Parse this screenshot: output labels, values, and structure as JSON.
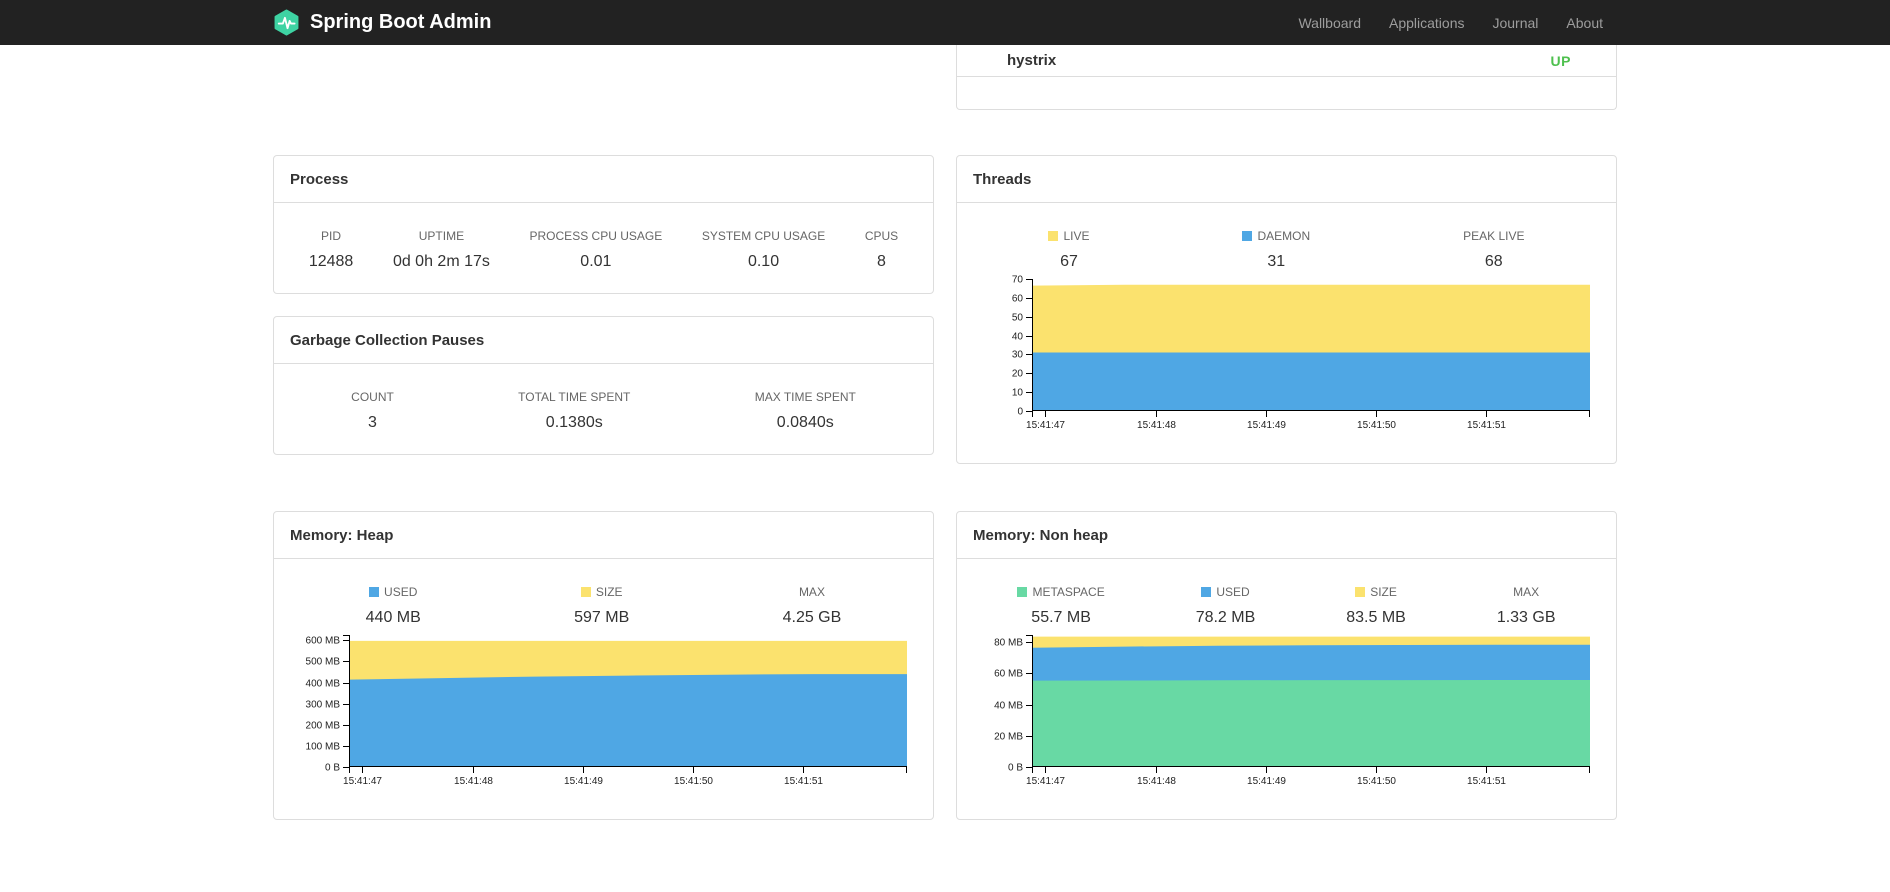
{
  "navbar": {
    "brand": "Spring Boot Admin",
    "items": [
      {
        "label": "Wallboard"
      },
      {
        "label": "Applications"
      },
      {
        "label": "Journal"
      },
      {
        "label": "About"
      }
    ]
  },
  "colors": {
    "logo_green": "#3ED3A3",
    "status_up": "#4EC04E",
    "series_blue": "#4FA7E4",
    "series_yellow": "#FBE26E",
    "series_green": "#68D9A4"
  },
  "application_row": {
    "name": "hystrix",
    "status": "UP"
  },
  "process": {
    "title": "Process",
    "stats": [
      {
        "label": "PID",
        "value": "12488"
      },
      {
        "label": "UPTIME",
        "value": "0d 0h 2m 17s"
      },
      {
        "label": "PROCESS CPU USAGE",
        "value": "0.01"
      },
      {
        "label": "SYSTEM CPU USAGE",
        "value": "0.10"
      },
      {
        "label": "CPUS",
        "value": "8"
      }
    ]
  },
  "gc": {
    "title": "Garbage Collection Pauses",
    "stats": [
      {
        "label": "COUNT",
        "value": "3"
      },
      {
        "label": "TOTAL TIME SPENT",
        "value": "0.1380s"
      },
      {
        "label": "MAX TIME SPENT",
        "value": "0.0840s"
      }
    ]
  },
  "threads": {
    "title": "Threads",
    "legend": [
      {
        "label": "LIVE",
        "color": "#FBE26E",
        "value": "67"
      },
      {
        "label": "DAEMON",
        "color": "#4FA7E4",
        "value": "31"
      },
      {
        "label": "PEAK LIVE",
        "value": "68"
      }
    ]
  },
  "heap": {
    "title": "Memory: Heap",
    "legend": [
      {
        "label": "USED",
        "color": "#4FA7E4",
        "value": "440 MB"
      },
      {
        "label": "SIZE",
        "color": "#FBE26E",
        "value": "597 MB"
      },
      {
        "label": "MAX",
        "value": "4.25 GB"
      }
    ]
  },
  "nonheap": {
    "title": "Memory: Non heap",
    "legend": [
      {
        "label": "METASPACE",
        "color": "#68D9A4",
        "value": "55.7 MB"
      },
      {
        "label": "USED",
        "color": "#4FA7E4",
        "value": "78.2 MB"
      },
      {
        "label": "SIZE",
        "color": "#FBE26E",
        "value": "83.5 MB"
      },
      {
        "label": "MAX",
        "value": "1.33 GB"
      }
    ]
  },
  "chart_data": [
    {
      "id": "threads",
      "type": "area",
      "title": "Threads",
      "xlabel": "",
      "ylabel": "",
      "ylim": [
        0,
        70
      ],
      "yticks": [
        {
          "v": 0,
          "label": "0"
        },
        {
          "v": 10,
          "label": "10"
        },
        {
          "v": 20,
          "label": "20"
        },
        {
          "v": 30,
          "label": "30"
        },
        {
          "v": 40,
          "label": "40"
        },
        {
          "v": 50,
          "label": "50"
        },
        {
          "v": 60,
          "label": "60"
        },
        {
          "v": 70,
          "label": "70"
        }
      ],
      "xticks": [
        {
          "pos": 0.024,
          "label": "15:41:47"
        },
        {
          "pos": 0.2216,
          "label": "15:41:48"
        },
        {
          "pos": 0.4192,
          "label": "15:41:49"
        },
        {
          "pos": 0.6168,
          "label": "15:41:50"
        },
        {
          "pos": 0.8144,
          "label": "15:41:51"
        }
      ],
      "series": [
        {
          "name": "live",
          "color": "#FBE26E",
          "values": [
            66.5,
            67,
            67,
            67,
            67,
            67,
            67
          ]
        },
        {
          "name": "daemon",
          "color": "#4FA7E4",
          "values": [
            31,
            31,
            31,
            31,
            31,
            31,
            31
          ]
        }
      ]
    },
    {
      "id": "heap",
      "type": "area",
      "title": "Memory: Heap",
      "xlabel": "",
      "ylabel": "",
      "ylim": [
        0,
        625
      ],
      "yticks": [
        {
          "v": 0,
          "label": "0 B"
        },
        {
          "v": 100,
          "label": "100 MB"
        },
        {
          "v": 200,
          "label": "200 MB"
        },
        {
          "v": 300,
          "label": "300 MB"
        },
        {
          "v": 400,
          "label": "400 MB"
        },
        {
          "v": 500,
          "label": "500 MB"
        },
        {
          "v": 600,
          "label": "600 MB"
        }
      ],
      "xticks": [
        {
          "pos": 0.024,
          "label": "15:41:47"
        },
        {
          "pos": 0.2216,
          "label": "15:41:48"
        },
        {
          "pos": 0.4192,
          "label": "15:41:49"
        },
        {
          "pos": 0.6168,
          "label": "15:41:50"
        },
        {
          "pos": 0.8144,
          "label": "15:41:51"
        }
      ],
      "series": [
        {
          "name": "size",
          "color": "#FBE26E",
          "values": [
            597,
            597,
            597,
            597,
            597,
            597,
            597
          ]
        },
        {
          "name": "used",
          "color": "#4FA7E4",
          "values": [
            414,
            421,
            428,
            433,
            437,
            440,
            440
          ]
        }
      ]
    },
    {
      "id": "nonheap",
      "type": "area",
      "title": "Memory: Non heap",
      "xlabel": "",
      "ylabel": "",
      "ylim": [
        0,
        84.5
      ],
      "yticks": [
        {
          "v": 0,
          "label": "0 B"
        },
        {
          "v": 20,
          "label": "20 MB"
        },
        {
          "v": 40,
          "label": "40 MB"
        },
        {
          "v": 60,
          "label": "60 MB"
        },
        {
          "v": 80,
          "label": "80 MB"
        }
      ],
      "xticks": [
        {
          "pos": 0.024,
          "label": "15:41:47"
        },
        {
          "pos": 0.2216,
          "label": "15:41:48"
        },
        {
          "pos": 0.4192,
          "label": "15:41:49"
        },
        {
          "pos": 0.6168,
          "label": "15:41:50"
        },
        {
          "pos": 0.8144,
          "label": "15:41:51"
        }
      ],
      "series": [
        {
          "name": "size",
          "color": "#FBE26E",
          "values": [
            83.5,
            83.5,
            83.5,
            83.5,
            83.5,
            83.5,
            83.5
          ]
        },
        {
          "name": "used",
          "color": "#4FA7E4",
          "values": [
            76.4,
            77.1,
            77.6,
            78,
            78.1,
            78.2,
            78.2
          ]
        },
        {
          "name": "metaspace",
          "color": "#68D9A4",
          "values": [
            55.3,
            55.4,
            55.5,
            55.6,
            55.6,
            55.7,
            55.7
          ]
        }
      ]
    }
  ]
}
